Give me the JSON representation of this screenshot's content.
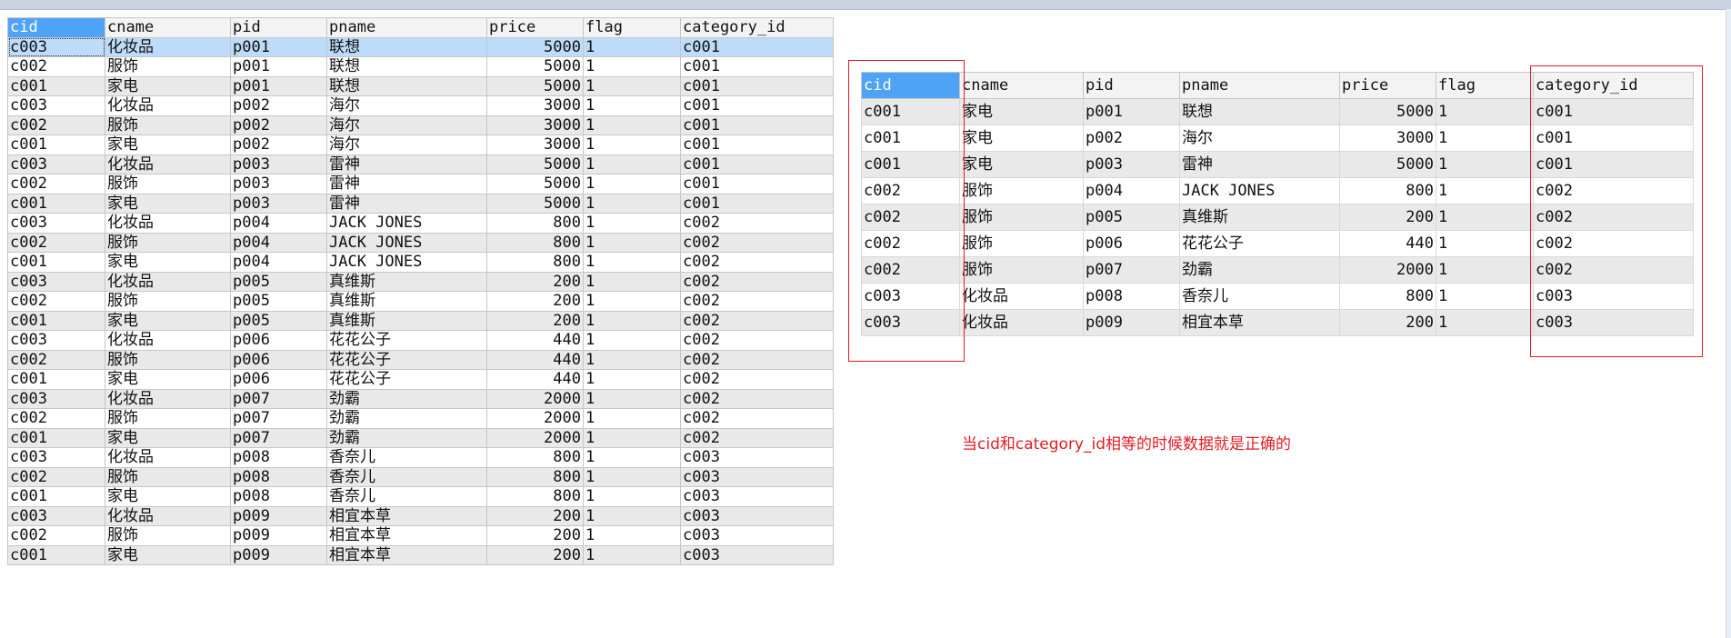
{
  "columns": [
    "cid",
    "cname",
    "pid",
    "pname",
    "price",
    "flag",
    "category_id"
  ],
  "main_rows": [
    [
      "c003",
      "化妆品",
      "p001",
      "联想",
      "5000",
      "1",
      "c001"
    ],
    [
      "c002",
      "服饰",
      "p001",
      "联想",
      "5000",
      "1",
      "c001"
    ],
    [
      "c001",
      "家电",
      "p001",
      "联想",
      "5000",
      "1",
      "c001"
    ],
    [
      "c003",
      "化妆品",
      "p002",
      "海尔",
      "3000",
      "1",
      "c001"
    ],
    [
      "c002",
      "服饰",
      "p002",
      "海尔",
      "3000",
      "1",
      "c001"
    ],
    [
      "c001",
      "家电",
      "p002",
      "海尔",
      "3000",
      "1",
      "c001"
    ],
    [
      "c003",
      "化妆品",
      "p003",
      "雷神",
      "5000",
      "1",
      "c001"
    ],
    [
      "c002",
      "服饰",
      "p003",
      "雷神",
      "5000",
      "1",
      "c001"
    ],
    [
      "c001",
      "家电",
      "p003",
      "雷神",
      "5000",
      "1",
      "c001"
    ],
    [
      "c003",
      "化妆品",
      "p004",
      "JACK JONES",
      "800",
      "1",
      "c002"
    ],
    [
      "c002",
      "服饰",
      "p004",
      "JACK JONES",
      "800",
      "1",
      "c002"
    ],
    [
      "c001",
      "家电",
      "p004",
      "JACK JONES",
      "800",
      "1",
      "c002"
    ],
    [
      "c003",
      "化妆品",
      "p005",
      "真维斯",
      "200",
      "1",
      "c002"
    ],
    [
      "c002",
      "服饰",
      "p005",
      "真维斯",
      "200",
      "1",
      "c002"
    ],
    [
      "c001",
      "家电",
      "p005",
      "真维斯",
      "200",
      "1",
      "c002"
    ],
    [
      "c003",
      "化妆品",
      "p006",
      "花花公子",
      "440",
      "1",
      "c002"
    ],
    [
      "c002",
      "服饰",
      "p006",
      "花花公子",
      "440",
      "1",
      "c002"
    ],
    [
      "c001",
      "家电",
      "p006",
      "花花公子",
      "440",
      "1",
      "c002"
    ],
    [
      "c003",
      "化妆品",
      "p007",
      "劲霸",
      "2000",
      "1",
      "c002"
    ],
    [
      "c002",
      "服饰",
      "p007",
      "劲霸",
      "2000",
      "1",
      "c002"
    ],
    [
      "c001",
      "家电",
      "p007",
      "劲霸",
      "2000",
      "1",
      "c002"
    ],
    [
      "c003",
      "化妆品",
      "p008",
      "香奈儿",
      "800",
      "1",
      "c003"
    ],
    [
      "c002",
      "服饰",
      "p008",
      "香奈儿",
      "800",
      "1",
      "c003"
    ],
    [
      "c001",
      "家电",
      "p008",
      "香奈儿",
      "800",
      "1",
      "c003"
    ],
    [
      "c003",
      "化妆品",
      "p009",
      "相宜本草",
      "200",
      "1",
      "c003"
    ],
    [
      "c002",
      "服饰",
      "p009",
      "相宜本草",
      "200",
      "1",
      "c003"
    ],
    [
      "c001",
      "家电",
      "p009",
      "相宜本草",
      "200",
      "1",
      "c003"
    ]
  ],
  "result_rows": [
    [
      "c001",
      "家电",
      "p001",
      "联想",
      "5000",
      "1",
      "c001"
    ],
    [
      "c001",
      "家电",
      "p002",
      "海尔",
      "3000",
      "1",
      "c001"
    ],
    [
      "c001",
      "家电",
      "p003",
      "雷神",
      "5000",
      "1",
      "c001"
    ],
    [
      "c002",
      "服饰",
      "p004",
      "JACK JONES",
      "800",
      "1",
      "c002"
    ],
    [
      "c002",
      "服饰",
      "p005",
      "真维斯",
      "200",
      "1",
      "c002"
    ],
    [
      "c002",
      "服饰",
      "p006",
      "花花公子",
      "440",
      "1",
      "c002"
    ],
    [
      "c002",
      "服饰",
      "p007",
      "劲霸",
      "2000",
      "1",
      "c002"
    ],
    [
      "c003",
      "化妆品",
      "p008",
      "香奈儿",
      "800",
      "1",
      "c003"
    ],
    [
      "c003",
      "化妆品",
      "p009",
      "相宜本草",
      "200",
      "1",
      "c003"
    ]
  ],
  "annotation": "当cid和category_id相等的时候数据就是正确的",
  "colors": {
    "selected_header": "#4fa3f6",
    "selected_row": "#bcdcfa",
    "highlight_box": "#e31b23",
    "annotation_text": "#e31b23"
  }
}
